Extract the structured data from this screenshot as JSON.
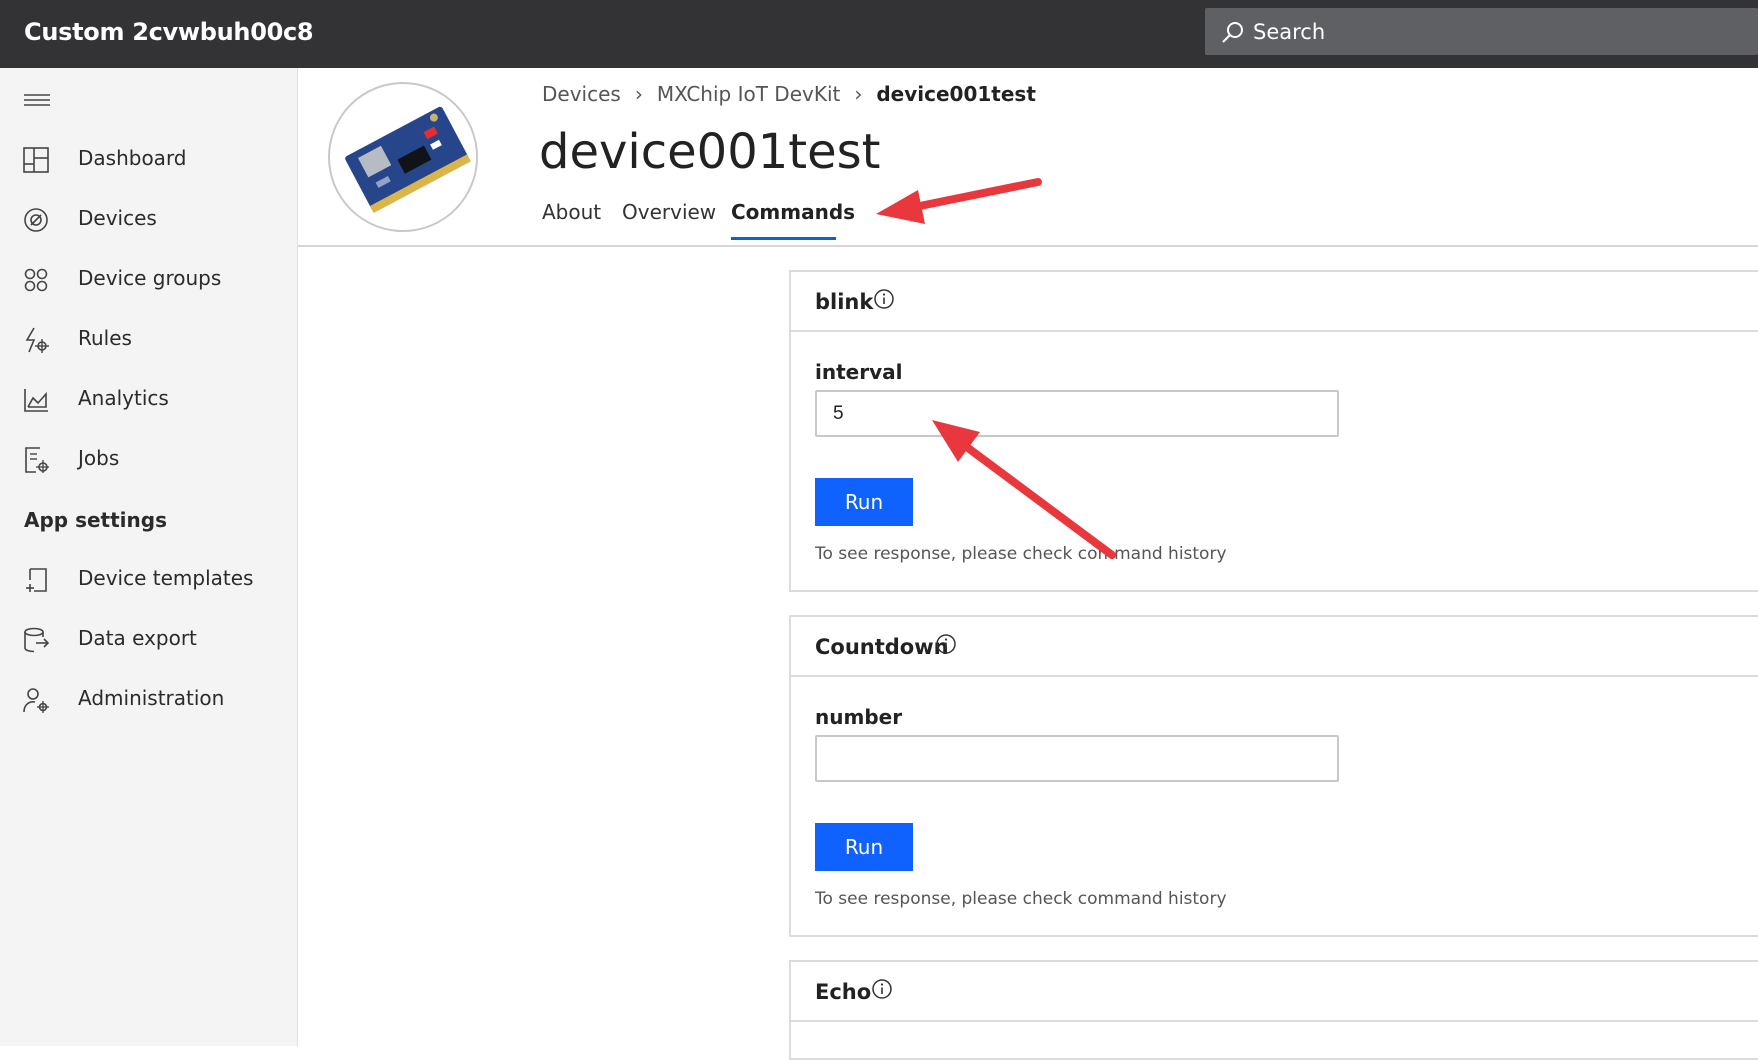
{
  "app": {
    "title": "Custom 2cvwbuh00c8"
  },
  "search": {
    "label": "Search"
  },
  "sidebar": {
    "items": [
      {
        "label": "Dashboard",
        "icon": "dashboard-icon"
      },
      {
        "label": "Devices",
        "icon": "devices-icon"
      },
      {
        "label": "Device groups",
        "icon": "device-groups-icon"
      },
      {
        "label": "Rules",
        "icon": "rules-icon"
      },
      {
        "label": "Analytics",
        "icon": "analytics-icon"
      },
      {
        "label": "Jobs",
        "icon": "jobs-icon"
      }
    ],
    "section": "App settings",
    "settings_items": [
      {
        "label": "Device templates",
        "icon": "device-templates-icon"
      },
      {
        "label": "Data export",
        "icon": "data-export-icon"
      },
      {
        "label": "Administration",
        "icon": "administration-icon"
      }
    ]
  },
  "breadcrumb": {
    "items": [
      "Devices",
      "MXChip IoT DevKit",
      "device001test"
    ]
  },
  "page": {
    "title": "device001test"
  },
  "tabs": [
    {
      "label": "About",
      "active": false
    },
    {
      "label": "Overview",
      "active": false
    },
    {
      "label": "Commands",
      "active": true
    }
  ],
  "commands": [
    {
      "name": "blink",
      "field_label": "interval",
      "value": "5",
      "run_label": "Run",
      "hint": "To see response, please check command history"
    },
    {
      "name": "Countdown",
      "field_label": "number",
      "value": "",
      "run_label": "Run",
      "hint": "To see response, please check command history"
    },
    {
      "name": "Echo"
    }
  ],
  "colors": {
    "topbar": "#333336",
    "accent": "#0f62fe",
    "annotation_arrow": "#e8383d"
  }
}
